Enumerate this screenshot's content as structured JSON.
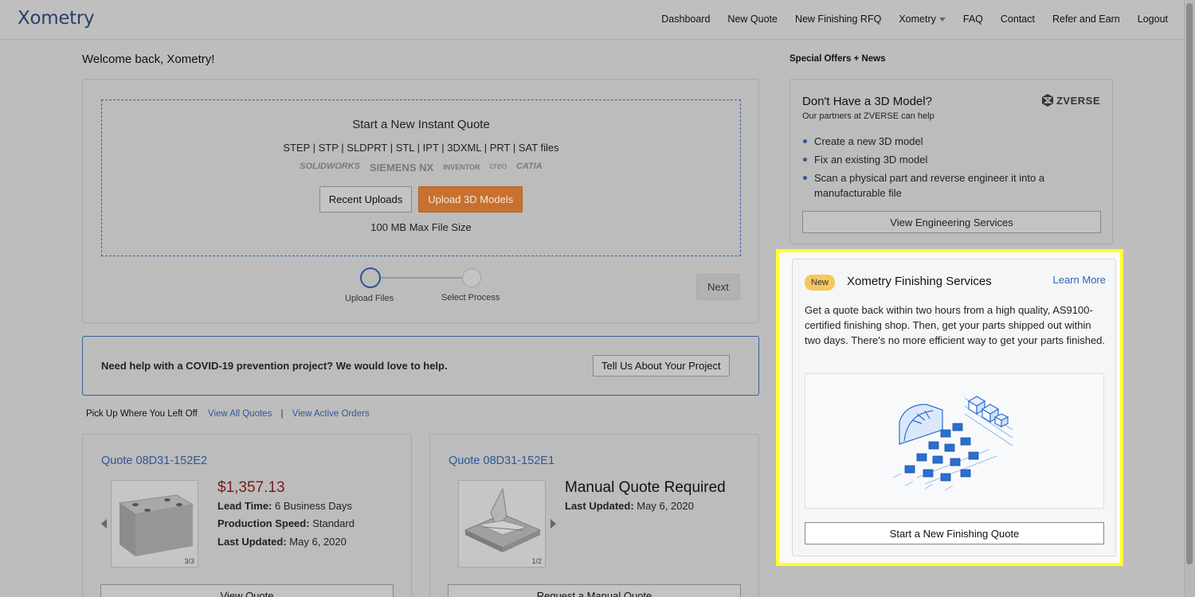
{
  "header": {
    "logo": "Xometry",
    "nav": [
      "Dashboard",
      "New Quote",
      "New Finishing RFQ",
      "Xometry",
      "FAQ",
      "Contact",
      "Refer and Earn",
      "Logout"
    ]
  },
  "welcome": "Welcome back, Xometry!",
  "instant_quote": {
    "title": "Start a New Instant Quote",
    "formats": "STEP | STP | SLDPRT | STL | IPT | 3DXML | PRT | SAT files",
    "cad_logos": [
      "SOLIDWORKS",
      "SIEMENS NX",
      "INVENTOR",
      "creo",
      "CATIA"
    ],
    "recent_uploads": "Recent Uploads",
    "upload": "Upload 3D Models",
    "max_size": "100 MB Max File Size",
    "step1": "Upload Files",
    "step2": "Select Process",
    "next": "Next"
  },
  "covid": {
    "text": "Need help with a COVID-19 prevention project? We would love to help.",
    "button": "Tell Us About Your Project"
  },
  "pickup": {
    "label": "Pick Up Where You Left Off",
    "view_quotes": "View All Quotes",
    "separator": "|",
    "view_orders": "View Active Orders"
  },
  "quotes": [
    {
      "id": "Quote 08D31-152E2",
      "price": "$1,357.13",
      "lead_label": "Lead Time:",
      "lead_value": "6 Business Days",
      "speed_label": "Production Speed:",
      "speed_value": "Standard",
      "updated_label": "Last Updated:",
      "updated_value": "May 6, 2020",
      "counter": "3/3",
      "button": "View Quote"
    },
    {
      "id": "Quote 08D31-152E1",
      "status": "Manual Quote Required",
      "updated_label": "Last Updated:",
      "updated_value": "May 6, 2020",
      "counter": "1/2",
      "button": "Request a Manual Quote"
    }
  ],
  "offers": {
    "title": "Special Offers + News",
    "zverse": {
      "title": "Don't Have a 3D Model?",
      "subtitle": "Our partners at ZVERSE can help",
      "logo": "ZVERSE",
      "items": [
        "Create a new 3D model",
        "Fix an existing 3D model",
        "Scan a physical part and reverse engineer it into a manufacturable file"
      ],
      "button": "View Engineering Services"
    },
    "finishing": {
      "badge": "New",
      "title": "Xometry Finishing Services",
      "learn_more": "Learn More",
      "description": "Get a quote back within two hours from a high quality, AS9100-certified finishing shop. Then, get your parts shipped out within two days. There's no more efficient way to get your parts finished.",
      "button": "Start a New Finishing Quote"
    }
  },
  "colors": {
    "accent_blue": "#2d5798",
    "upload_orange": "#c8702f",
    "price_red": "#7a1b1b",
    "badge_yellow": "#f6c75d",
    "highlight": "#ffff33"
  }
}
